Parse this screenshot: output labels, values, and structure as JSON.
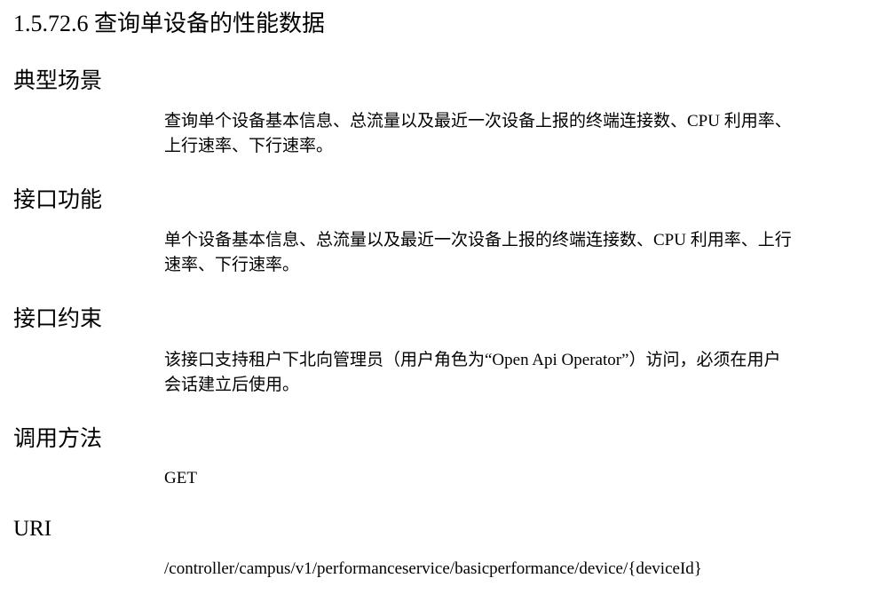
{
  "document": {
    "title": "1.5.72.6 查询单设备的性能数据",
    "sections": [
      {
        "heading": "典型场景",
        "lines": [
          "查询单个设备基本信息、总流量以及最近一次设备上报的终端连接数、CPU 利用率、",
          "上行速率、下行速率。"
        ]
      },
      {
        "heading": "接口功能",
        "lines": [
          "单个设备基本信息、总流量以及最近一次设备上报的终端连接数、CPU 利用率、上行",
          "速率、下行速率。"
        ]
      },
      {
        "heading": "接口约束",
        "lines": [
          "该接口支持租户下北向管理员（用户角色为“Open Api Operator”）访问，必须在用户",
          "会话建立后使用。"
        ]
      },
      {
        "heading": "调用方法",
        "lines": [
          "GET"
        ]
      },
      {
        "heading": "URI",
        "lines": [
          "/controller/campus/v1/performanceservice/basicperformance/device/{deviceId}"
        ]
      }
    ]
  }
}
